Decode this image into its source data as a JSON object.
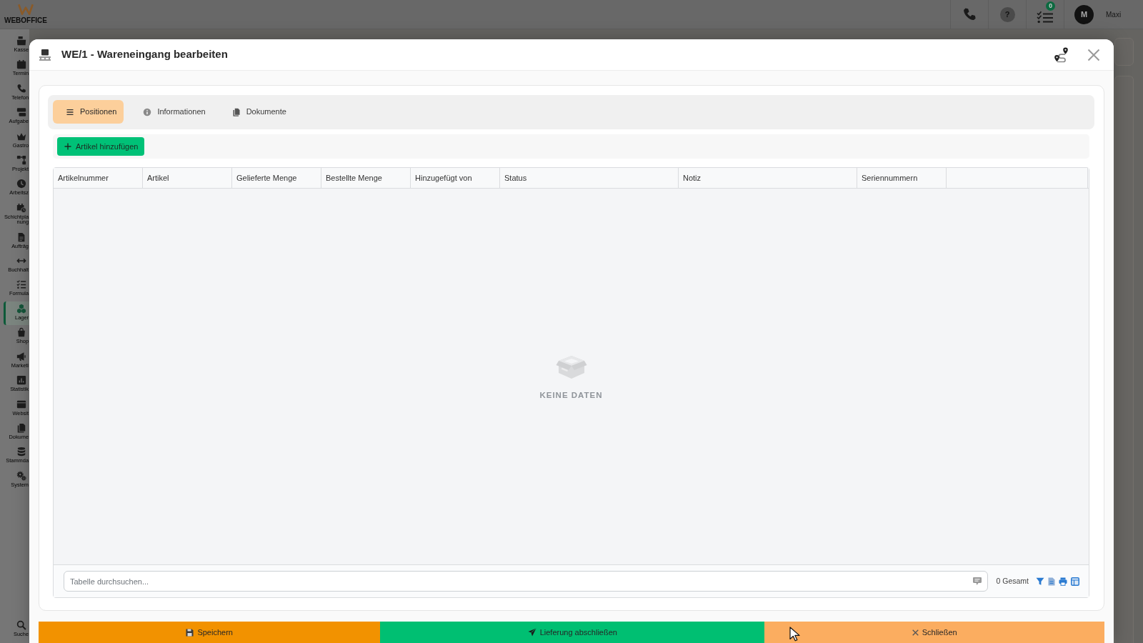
{
  "topbar": {
    "logo_text": "WEBOFFICE",
    "help_glyph": "?",
    "task_count": "0",
    "avatar_initial": "M",
    "user_name": "Maxi"
  },
  "sidebar": {
    "items": [
      {
        "label": "Kasse",
        "selected": false
      },
      {
        "label": "Termin",
        "selected": false
      },
      {
        "label": "Telefon",
        "selected": false
      },
      {
        "label": "Aufgabe",
        "selected": false
      },
      {
        "label": "Gastro",
        "selected": false
      },
      {
        "label": "Projekt",
        "selected": false
      },
      {
        "label": "Arbeitsz",
        "selected": false
      },
      {
        "label": "Schichtpla nung",
        "selected": false
      },
      {
        "label": "Aufträg",
        "selected": false
      },
      {
        "label": "Buchhalt",
        "selected": false
      },
      {
        "label": "Formula",
        "selected": false
      },
      {
        "label": "Lager",
        "selected": true
      },
      {
        "label": "Shop",
        "selected": false
      },
      {
        "label": "Marketi",
        "selected": false
      },
      {
        "label": "Statistik",
        "selected": false
      },
      {
        "label": "Websit",
        "selected": false
      },
      {
        "label": "Dokume",
        "selected": false
      },
      {
        "label": "Stammda",
        "selected": false
      },
      {
        "label": "System",
        "selected": false
      }
    ],
    "bottom_item": {
      "label": "Suche"
    }
  },
  "modal": {
    "title": "WE/1 - Wareneingang bearbeiten",
    "tabs": [
      {
        "label": "Positionen",
        "selected": true
      },
      {
        "label": "Informationen",
        "selected": false
      },
      {
        "label": "Dokumente",
        "selected": false
      }
    ],
    "add_button": "Artikel hinzufügen",
    "table": {
      "columns": [
        "Artikelnummer",
        "Artikel",
        "Gelieferte Menge",
        "Bestellte Menge",
        "Hinzugefügt von",
        "Status",
        "Notiz",
        "Seriennummern"
      ],
      "empty_text": "KEINE DATEN"
    },
    "search": {
      "placeholder": "Tabelle durchsuchen..."
    },
    "total": "0 Gesamt",
    "footer_buttons": [
      {
        "kind": "save",
        "label": "Speichern"
      },
      {
        "kind": "complete",
        "label": "Lieferung abschließen"
      },
      {
        "kind": "close",
        "label": "Schließen"
      }
    ]
  }
}
